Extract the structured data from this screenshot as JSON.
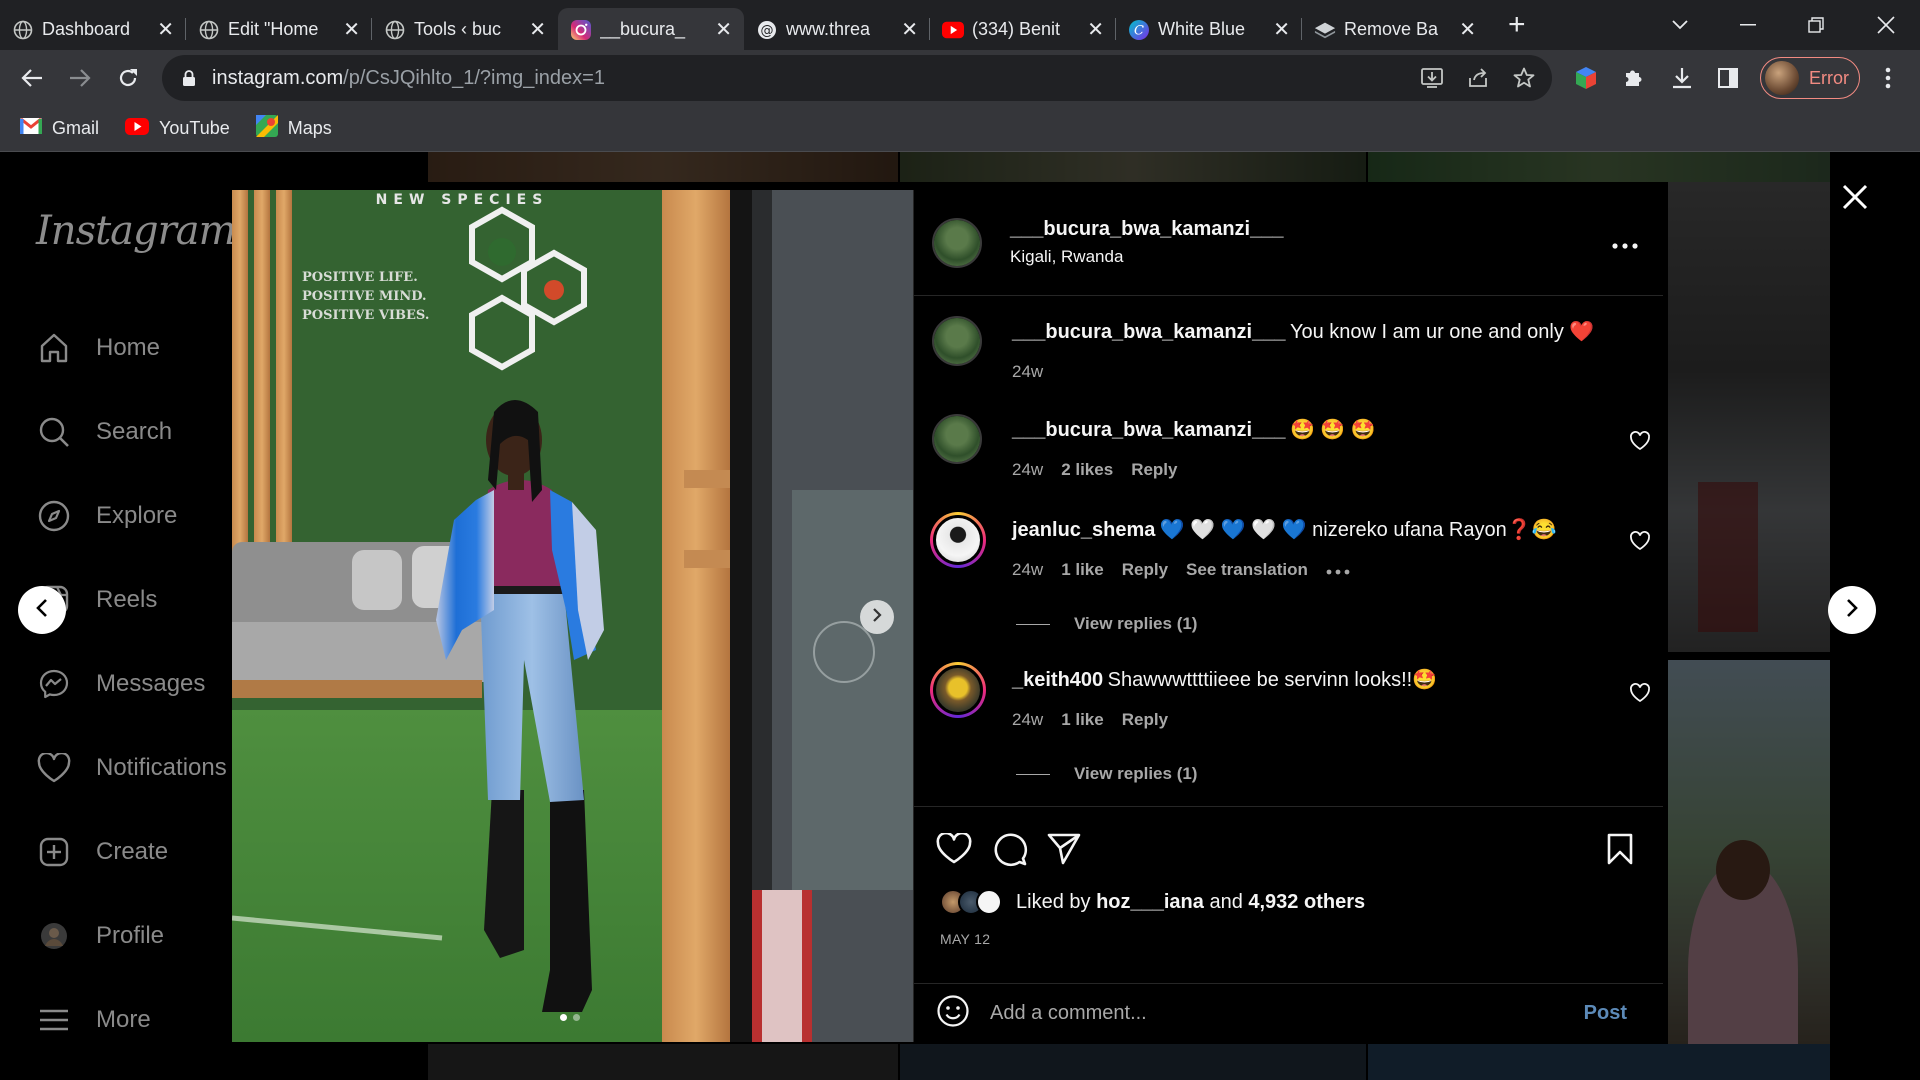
{
  "browser": {
    "tabs": [
      {
        "title": "Dashboard",
        "icon": "globe-icon"
      },
      {
        "title": "Edit \"Home",
        "icon": "globe-icon"
      },
      {
        "title": "Tools ‹ buc",
        "icon": "globe-icon"
      },
      {
        "title": "__bucura_",
        "icon": "instagram-icon",
        "active": true
      },
      {
        "title": "www.threa",
        "icon": "threads-icon"
      },
      {
        "title": "(334) Benit",
        "icon": "youtube-icon"
      },
      {
        "title": "White Blue",
        "icon": "canva-icon"
      },
      {
        "title": "Remove Ba",
        "icon": "removebg-icon"
      }
    ],
    "url_host": "instagram.com",
    "url_path": "/p/CsJQihlto_1/?img_index=1",
    "profile_label": "Error",
    "bookmarks": [
      {
        "label": "Gmail",
        "icon": "gmail-icon"
      },
      {
        "label": "YouTube",
        "icon": "youtube-icon"
      },
      {
        "label": "Maps",
        "icon": "maps-icon"
      }
    ]
  },
  "instagram": {
    "logo": "Instagram",
    "nav": [
      {
        "label": "Home",
        "icon": "home-icon"
      },
      {
        "label": "Search",
        "icon": "search-icon"
      },
      {
        "label": "Explore",
        "icon": "compass-icon"
      },
      {
        "label": "Reels",
        "icon": "reels-icon"
      },
      {
        "label": "Messages",
        "icon": "messenger-icon"
      },
      {
        "label": "Notifications",
        "icon": "heart-icon"
      },
      {
        "label": "Create",
        "icon": "plus-square-icon"
      },
      {
        "label": "Profile",
        "icon": "profile-avatar-icon"
      },
      {
        "label": "More",
        "icon": "menu-icon"
      }
    ]
  },
  "post": {
    "photo_text": {
      "sign": "NEW SPECIES",
      "wall_lines": [
        "POSITIVE LIFE.",
        "POSITIVE MIND.",
        "POSITIVE VIBES."
      ]
    },
    "carousel": {
      "count": 2,
      "current": 1
    },
    "author": "___bucura_bwa_kamanzi___",
    "location": "Kigali, Rwanda",
    "caption": {
      "user": "___bucura_bwa_kamanzi___",
      "text": "You know I am ur one and only ❤️",
      "time": "24w"
    },
    "comments": [
      {
        "user": "___bucura_bwa_kamanzi___",
        "text": "🤩 🤩 🤩",
        "time": "24w",
        "likes": "2 likes",
        "reply": "Reply"
      },
      {
        "user": "jeanluc_shema",
        "text": "💙 🤍 💙 🤍 💙 nizereko ufana Rayon❓😂",
        "time": "24w",
        "likes": "1 like",
        "reply": "Reply",
        "translate": "See translation",
        "view_replies": "View replies (1)"
      },
      {
        "user": "_keith400",
        "text": "Shawwwttttiieee be servinn looks!!🤩",
        "time": "24w",
        "likes": "1 like",
        "reply": "Reply",
        "view_replies": "View replies (1)"
      }
    ],
    "liked_by_prefix": "Liked by ",
    "liked_by_user": "hoz___iana",
    "liked_by_and": " and ",
    "liked_by_others": "4,932 others",
    "date": "MAY 12",
    "comment_placeholder": "Add a comment...",
    "post_button": "Post"
  },
  "colors": {
    "background": "#000000",
    "text": "#f5f5f5",
    "secondary_text": "#a8a8a8",
    "post_button": "#5c8ab8",
    "divider": "#262626"
  }
}
